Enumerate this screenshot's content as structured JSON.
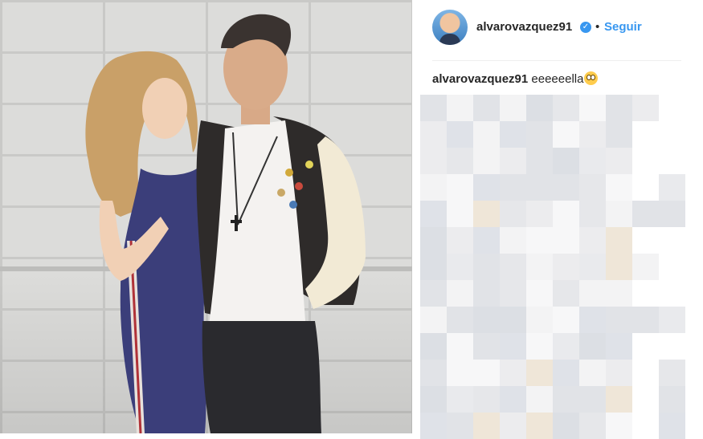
{
  "post": {
    "username": "alvarovazquez91",
    "separator": "•",
    "follow_label": "Seguir",
    "verified_icon": "check-icon"
  },
  "caption": {
    "user": "alvarovazquez91",
    "text": "eeeeeella",
    "emoji": "flushed-face-emoji"
  },
  "colors": {
    "link": "#3897f0",
    "text": "#262626",
    "divider": "#efefef"
  }
}
